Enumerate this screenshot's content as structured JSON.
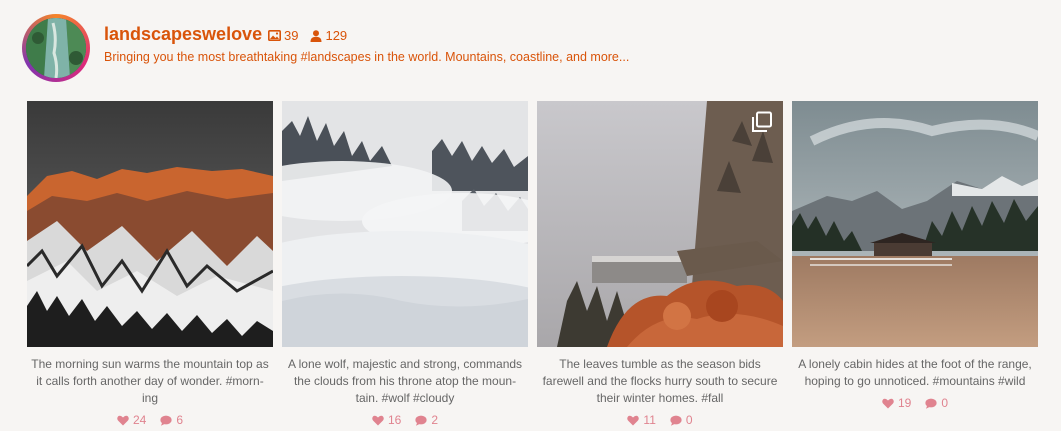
{
  "profile": {
    "username": "landscapeswelove",
    "posts_count": "39",
    "followers_count": "129",
    "bio": "Bringing you the most breathtaking #landscapes in the world. Mountains, coastline, and more...",
    "accent_color": "#d9540a"
  },
  "icons": {
    "posts": "image-icon",
    "followers": "person-icon",
    "likes": "heart-icon",
    "comments": "comment-icon",
    "multi": "multiple-photos-icon"
  },
  "posts": [
    {
      "caption": "The morning sun warms the mountain top as it calls forth another day of wonder. #morn-ing",
      "likes": "24",
      "comments": "6"
    },
    {
      "caption": "A lone wolf, majestic and strong, commands the clouds from his throne atop the moun-tain. #wolf #cloudy",
      "likes": "16",
      "comments": "2"
    },
    {
      "caption": "The leaves tumble as the season bids farewell and the flocks hurry south to secure their winter homes. #fall",
      "likes": "11",
      "comments": "0"
    },
    {
      "caption": "A lonely cabin hides at the foot of the range, hoping to go unnoticed. #mountains #wild",
      "likes": "19",
      "comments": "0"
    }
  ]
}
